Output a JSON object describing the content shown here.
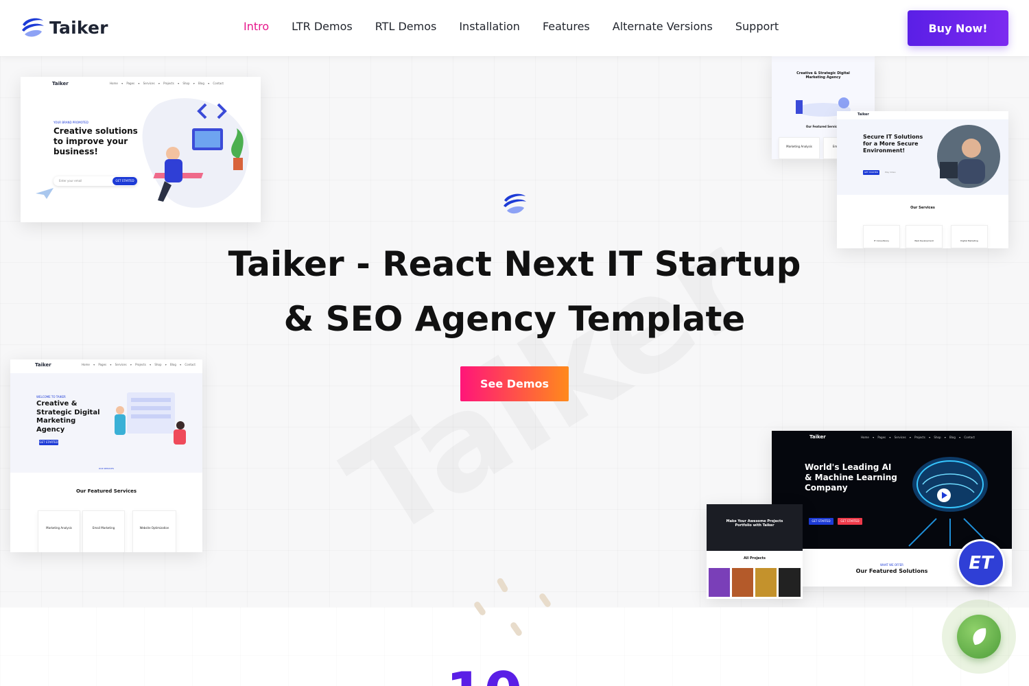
{
  "header": {
    "brand": "Taiker",
    "nav": [
      "Intro",
      "LTR Demos",
      "RTL Demos",
      "Installation",
      "Features",
      "Alternate Versions",
      "Support"
    ],
    "active_nav": "Intro",
    "buy_label": "Buy Now!"
  },
  "hero": {
    "title_line1": "Taiker - React Next IT Startup",
    "title_line2": "& SEO Agency Template",
    "cta_label": "See Demos",
    "watermark": "Taiker"
  },
  "previews": {
    "p1": {
      "brand": "Taiker",
      "menu": "Home ▾ Pages ▾ Services ▾ Projects ▾ Shop ▾ Blog ▾ Contact",
      "tag": "YOUR BRAND PROMOTED",
      "heading": "Creative solutions to improve your business!",
      "input_placeholder": "Enter your email",
      "button": "GET STARTED"
    },
    "p2": {
      "brand": "Taiker",
      "menu": "Home ▾ Pages ▾ Services ▾ Projects ▾ Shop ▾ Blog ▾ Contact",
      "tag": "WELCOME TO TAIKER",
      "heading": "Creative & Strategic Digital Marketing Agency",
      "button": "GET STARTED",
      "section_tag": "OUR SERVICES",
      "section_title": "Our Featured Services",
      "cards": [
        "Marketing Analysis",
        "Email Marketing",
        "Website Optimization"
      ],
      "card_button": "READ MORE"
    },
    "p3": {
      "heading": "Creative & Strategic Digital Marketing Agency",
      "section_title": "Our Featured Services",
      "cards": [
        "Marketing Analysis",
        "Email Marketing"
      ]
    },
    "p4": {
      "brand": "Taiker",
      "heading": "Secure IT Solutions for a More Secure Environment!",
      "button": "GET STARTED",
      "play_label": "Play Video",
      "section_title": "Our Services",
      "cards": [
        "IT Consultancy",
        "Web Development",
        "Digital Marketing"
      ]
    },
    "p5": {
      "brand": "Taiker",
      "menu": "Home ▾ Pages ▾ Services ▾ Projects ▾ Shop ▾ Blog ▾ Contact",
      "heading": "World's Leading AI & Machine Learning Company",
      "button1": "GET STARTED",
      "button2": "GET STARTED",
      "section_tag": "WHAT WE OFFER",
      "section_title": "Our Featured Solutions"
    },
    "p6": {
      "heading": "Make Your Awesome Projects Portfolio with Taiker",
      "section_title": "All Projects"
    }
  },
  "badges": {
    "et": "ET"
  },
  "lower": {
    "counter_fragment": "10"
  },
  "colors": {
    "accent_pink": "#e6178b",
    "accent_purple": "#5a1fe6",
    "cta_start": "#ff1579",
    "cta_end": "#ff8a1c"
  }
}
